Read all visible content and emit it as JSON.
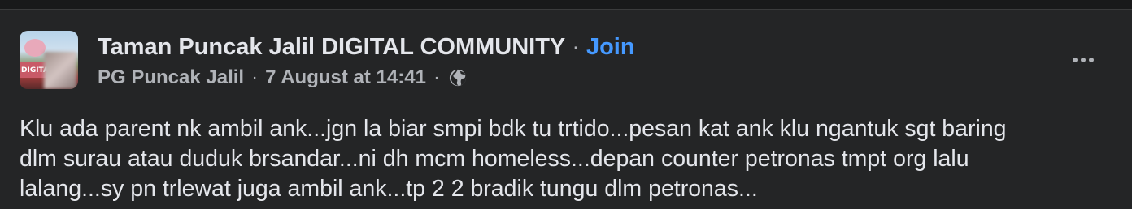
{
  "post": {
    "group_name": "Taman Puncak Jalil DIGITAL COMMUNITY",
    "separator": "·",
    "join_label": "Join",
    "author": "PG Puncak Jalil",
    "timestamp": "7 August at 14:41",
    "privacy_icon": "globe-icon",
    "avatar_badge": "DIGITAL",
    "more_icon": "more-options-icon",
    "text_lines": [
      "Klu ada parent nk ambil ank...jgn la biar smpi bdk tu trtido...pesan kat ank klu ngantuk sgt baring",
      "dlm surau atau duduk brsandar...ni dh mcm homeless...depan counter petronas tmpt org lalu",
      "lalang...sy pn trlewat juga ambil ank...tp 2 2 bradik tungu dlm petronas..."
    ]
  },
  "colors": {
    "background": "#242526",
    "primary_text": "#e4e6eb",
    "secondary_text": "#b0b3b8",
    "link_blue": "#4599ff"
  }
}
